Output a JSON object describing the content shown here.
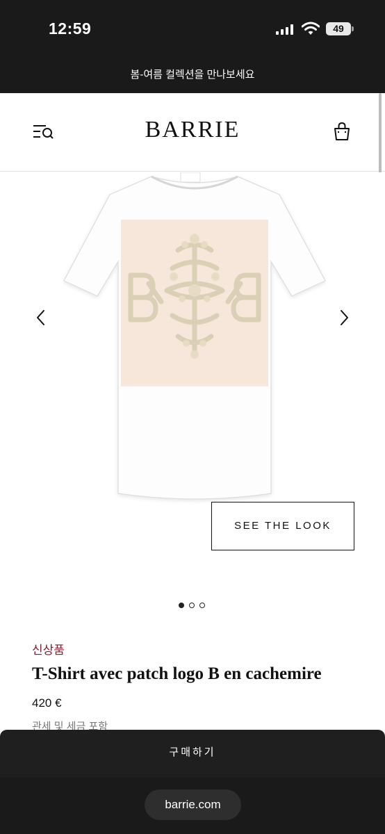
{
  "status_bar": {
    "time": "12:59",
    "battery": "49"
  },
  "announcement": {
    "text": "봄-여름 컬렉션을 만나보세요"
  },
  "header": {
    "logo": "BARRIE",
    "menu_icon": "menu-search-icon",
    "cart_icon": "shopping-bag-icon"
  },
  "gallery": {
    "prev_icon": "chevron-left-icon",
    "next_icon": "chevron-right-icon",
    "see_the_look": "SEE THE LOOK",
    "image_count": 3,
    "active_index": 0
  },
  "product": {
    "badge": "신상품",
    "title": "T-Shirt avec patch logo B en cachemire",
    "price": "420 €",
    "tax_note": "관세 및 세금 포함"
  },
  "buy_button": {
    "label": "구매하기"
  },
  "browser": {
    "url": "barrie.com"
  },
  "colors": {
    "dark_bar": "#1a1a1a",
    "badge": "#8c1c2b",
    "patch": "#f7e6da"
  }
}
